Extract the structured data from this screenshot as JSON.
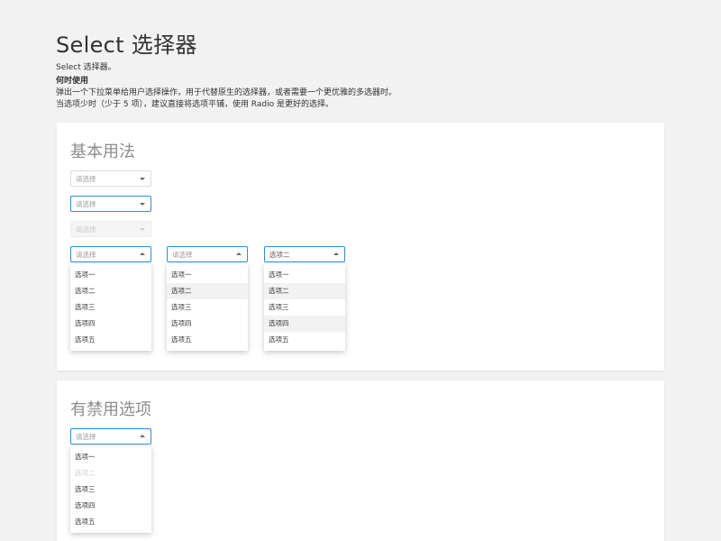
{
  "header": {
    "title": "Select 选择器",
    "subtitle": "Select 选择器。",
    "when_heading": "何时使用",
    "when_line1": "弹出一个下拉菜单给用户选择操作，用于代替原生的选择器，或者需要一个更优雅的多选器时。",
    "when_line2": "当选项少时（少于 5 项），建议直接将选项平铺，使用 Radio 是更好的选择。"
  },
  "basic": {
    "title": "基本用法",
    "select1": {
      "placeholder": "请选择"
    },
    "select2": {
      "placeholder": "请选择"
    },
    "select3": {
      "placeholder": "请选择"
    },
    "open_a": {
      "placeholder": "请选择",
      "options": [
        "选项一",
        "选项二",
        "选项三",
        "选项四",
        "选项五"
      ]
    },
    "open_b": {
      "placeholder": "请选择",
      "options": [
        "选项一",
        "选项二",
        "选项三",
        "选项四",
        "选项五"
      ]
    },
    "open_c": {
      "value": "选项二",
      "options": [
        "选项一",
        "选项二",
        "选项三",
        "选项四",
        "选项五"
      ]
    }
  },
  "disabled_options": {
    "title": "有禁用选项",
    "select": {
      "placeholder": "请选择",
      "options": [
        "选项一",
        "选项二",
        "选项三",
        "选项四",
        "选项五"
      ]
    }
  },
  "colors": {
    "focus": "#2f8be6",
    "hover_bg": "#f2f2f2",
    "disabled_text": "#cfcfcf"
  }
}
